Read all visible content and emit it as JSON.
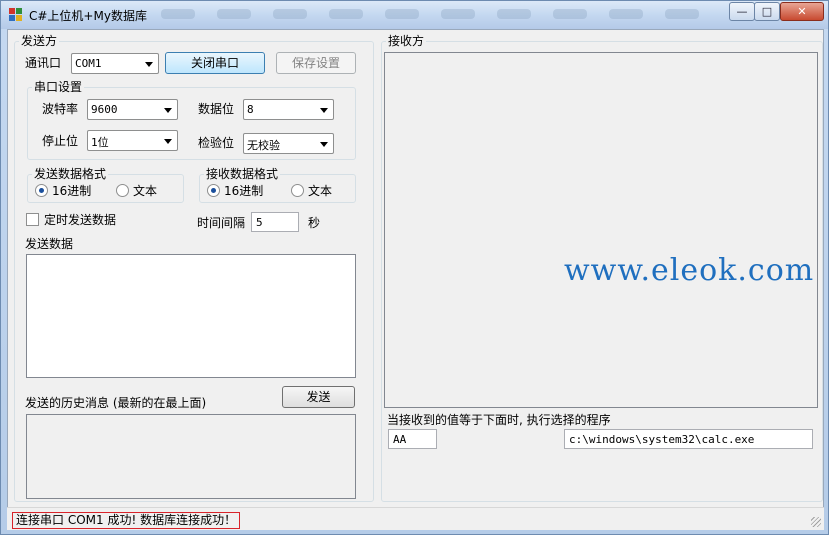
{
  "window": {
    "title": "C#上位机+My数据库",
    "minimize_icon": "minimize-icon",
    "maximize_icon": "maximize-icon",
    "close_icon": "close-icon"
  },
  "sender": {
    "group_title": "发送方",
    "port_label": "通讯口",
    "port_value": "COM1",
    "close_port_button": "关闭串口",
    "save_settings_button": "保存设置",
    "serial_settings": {
      "title": "串口设置",
      "baud_label": "波特率",
      "baud_value": "9600",
      "databits_label": "数据位",
      "databits_value": "8",
      "stopbits_label": "停止位",
      "stopbits_value": "1位",
      "parity_label": "检验位",
      "parity_value": "无校验"
    },
    "send_format": {
      "title": "发送数据格式",
      "option_hex": "16进制",
      "option_text": "文本",
      "selected": "16进制"
    },
    "receive_format": {
      "title": "接收数据格式",
      "option_hex": "16进制",
      "option_text": "文本",
      "selected": "16进制"
    },
    "timed_send_label": "定时发送数据",
    "timed_send_checked": false,
    "interval_label": "时间间隔",
    "interval_value": "5",
    "interval_unit": "秒",
    "send_data_label": "发送数据",
    "send_data_value": "",
    "send_button": "发送",
    "history_label": "发送的历史消息 (最新的在最上面)",
    "history_value": ""
  },
  "receiver": {
    "group_title": "接收方",
    "received_value": "",
    "trigger_label": "当接收到的值等于下面时, 执行选择的程序",
    "trigger_value": "AA",
    "program_path": "c:\\windows\\system32\\calc.exe"
  },
  "watermark": "www.eleok.com",
  "status": {
    "message": "连接串口 COM1 成功! 数据库连接成功！"
  },
  "colors": {
    "watermark": "#1f6fbf",
    "status_border": "#d8232a",
    "radio_dot": "#1b4f9c"
  }
}
